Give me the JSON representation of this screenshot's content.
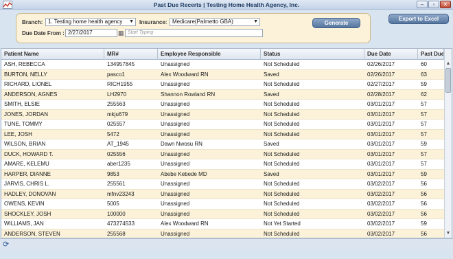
{
  "window": {
    "title": "Past Due Recerts | Testing Home Health Agency, Inc.",
    "app_icon": "chart-app-icon",
    "controls": [
      "minimize-icon",
      "maximize-icon",
      "close-icon"
    ]
  },
  "filters": {
    "branch_label": "Branch:",
    "branch_value": "1. Testing home health agency",
    "insurance_label": "Insurance:",
    "insurance_value": "Medicare(Palmetto GBA)",
    "due_date_label": "Due Date From :",
    "due_date_value": "2/27/2017",
    "search_placeholder": "Start Typing",
    "generate_label": "Generate"
  },
  "toolbar": {
    "export_label": "Export to Excel"
  },
  "grid": {
    "columns": [
      "Patient Name",
      "MR#",
      "Employee Responsible",
      "Status",
      "Due Date",
      "Past Due"
    ],
    "rows": [
      [
        "ASH, REBECCA",
        "134957845",
        "Unassigned",
        "Not Scheduled",
        "02/26/2017",
        "60"
      ],
      [
        "BURTON, NELLY",
        "pasco1",
        "Alex Woodward RN",
        "Saved",
        "02/26/2017",
        "63"
      ],
      [
        "RICHARD, LIONEL",
        "RICH1955",
        "Unassigned",
        "Not Scheduled",
        "02/27/2017",
        "59"
      ],
      [
        "ANDERSON, AGNES",
        "LH2970",
        "Shannon Rowland RN",
        "Saved",
        "02/28/2017",
        "62"
      ],
      [
        "SMITH, ELSIE",
        "255563",
        "Unassigned",
        "Not Scheduled",
        "03/01/2017",
        "57"
      ],
      [
        "JONES, JORDAN",
        "mkju679",
        "Unassigned",
        "Not Scheduled",
        "03/01/2017",
        "57"
      ],
      [
        "TUNE, TOMMY",
        "025557",
        "Unassigned",
        "Not Scheduled",
        "03/01/2017",
        "57"
      ],
      [
        "LEE, JOSH",
        "5472",
        "Unassigned",
        "Not Scheduled",
        "03/01/2017",
        "57"
      ],
      [
        "WILSON, BRIAN",
        "AT_1945",
        "Dawn Nwosu RN",
        "Saved",
        "03/01/2017",
        "59"
      ],
      [
        "DUCK, HOWARD T.",
        "025556",
        "Unassigned",
        "Not Scheduled",
        "03/01/2017",
        "57"
      ],
      [
        "AMARE, KELEMU",
        "aber1235",
        "Unassigned",
        "Not Scheduled",
        "03/01/2017",
        "57"
      ],
      [
        "HARPER, DIANNE",
        "9853",
        "Abebe Kebede MD",
        "Saved",
        "03/01/2017",
        "59"
      ],
      [
        "JARVIS, CHRIS L.",
        "255561",
        "Unassigned",
        "Not Scheduled",
        "03/02/2017",
        "56"
      ],
      [
        "HADLEY, DONOVAN",
        "mfnv23243",
        "Unassigned",
        "Not Scheduled",
        "03/02/2017",
        "56"
      ],
      [
        "OWENS, KEVIN",
        "5005",
        "Unassigned",
        "Not Scheduled",
        "03/02/2017",
        "56"
      ],
      [
        "SHOCKLEY, JOSH",
        "100000",
        "Unassigned",
        "Not Scheduled",
        "03/02/2017",
        "56"
      ],
      [
        "WILLIAMS, JAN",
        "473274533",
        "Alex Woodward RN",
        "Not Yet Started",
        "03/02/2017",
        "59"
      ],
      [
        "ANDERSON, STEVEN",
        "255568",
        "Unassigned",
        "Not Scheduled",
        "03/02/2017",
        "56"
      ]
    ]
  },
  "statusbar": {
    "refresh_icon": "refresh-icon"
  }
}
